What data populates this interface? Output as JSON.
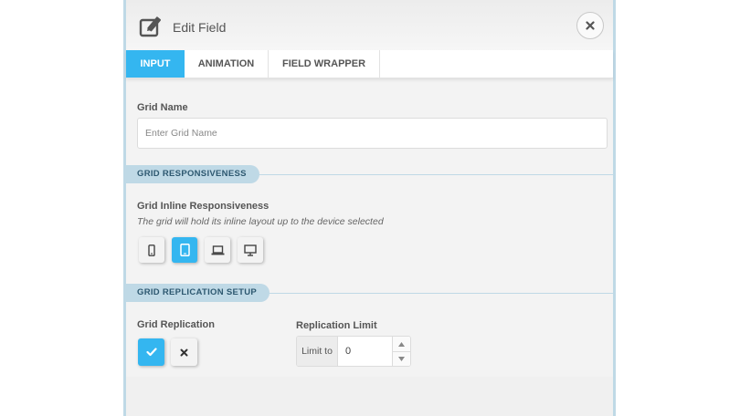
{
  "dialog": {
    "title": "Edit Field"
  },
  "tabs": [
    {
      "label": "INPUT",
      "active": true
    },
    {
      "label": "ANIMATION",
      "active": false
    },
    {
      "label": "FIELD WRAPPER",
      "active": false
    }
  ],
  "grid_name": {
    "label": "Grid Name",
    "placeholder": "Enter Grid Name",
    "value": ""
  },
  "responsiveness_section": {
    "heading": "GRID RESPONSIVENESS",
    "label": "Grid Inline Responsiveness",
    "help": "The grid will hold its inline layout up to the device selected",
    "devices": [
      {
        "icon": "mobile-icon",
        "selected": false
      },
      {
        "icon": "tablet-icon",
        "selected": true
      },
      {
        "icon": "laptop-icon",
        "selected": false
      },
      {
        "icon": "desktop-icon",
        "selected": false
      }
    ]
  },
  "replication_section": {
    "heading": "GRID REPLICATION SETUP",
    "replication_label": "Grid Replication",
    "replication_enabled": true,
    "limit_label": "Replication Limit",
    "limit_prefix": "Limit to",
    "limit_value": "0"
  },
  "colors": {
    "accent": "#34b6f0",
    "section_band": "#bfd9e6",
    "section_text": "#2d5870",
    "panel_bg": "#f3f3f3"
  }
}
